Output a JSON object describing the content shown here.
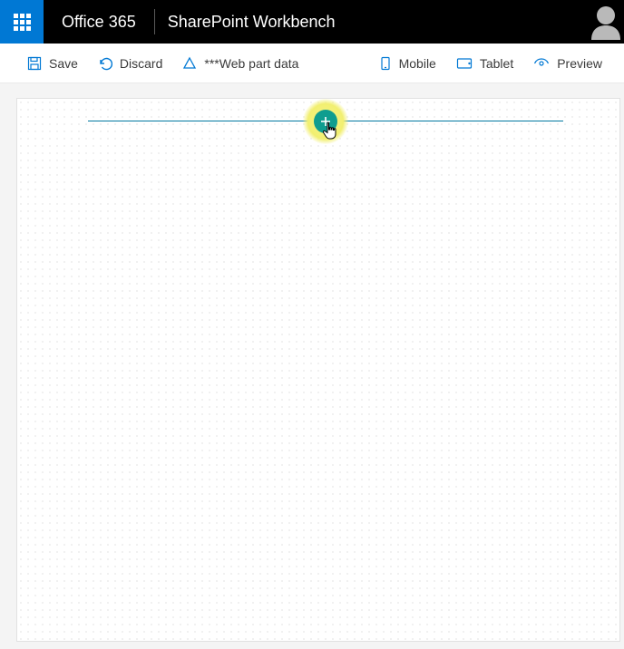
{
  "header": {
    "suite": "Office 365",
    "page": "SharePoint Workbench"
  },
  "commands": {
    "save": "Save",
    "discard": "Discard",
    "webpartdata": "***Web part data",
    "mobile": "Mobile",
    "tablet": "Tablet",
    "preview": "Preview"
  }
}
